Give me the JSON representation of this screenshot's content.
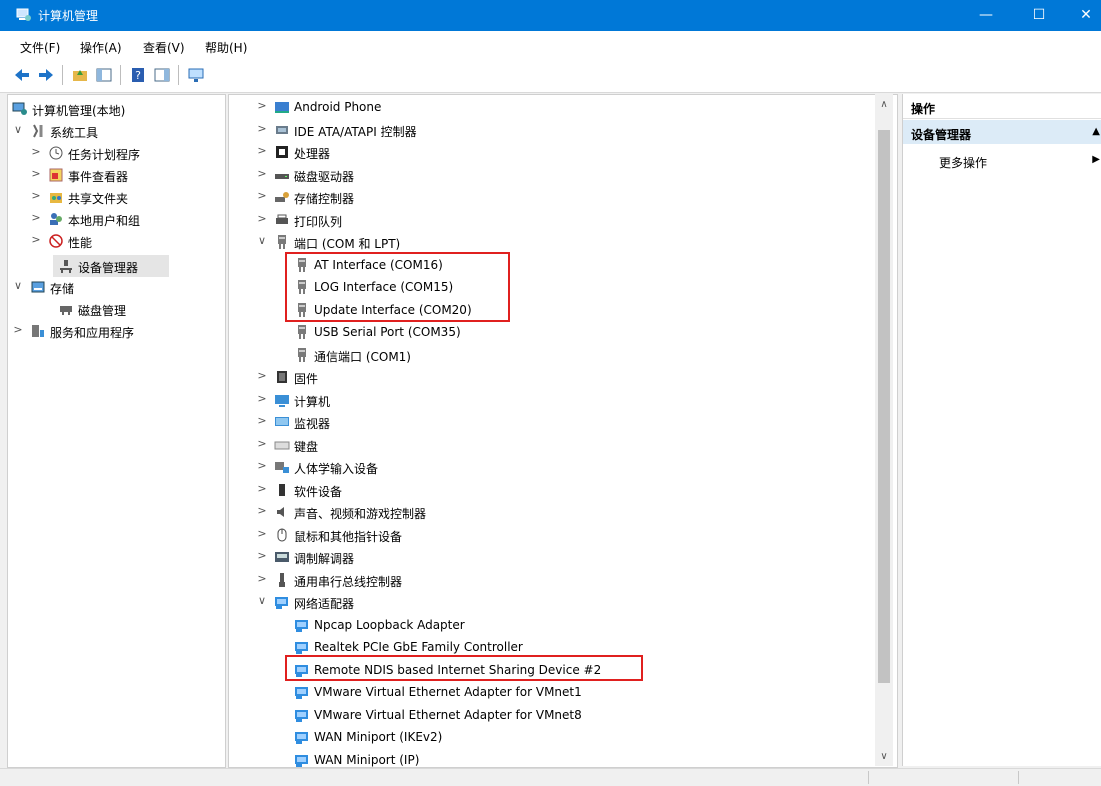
{
  "window": {
    "title": "计算机管理",
    "minimize_glyph": "—",
    "maximize_glyph": "☐",
    "close_glyph": "✕"
  },
  "menu": [
    "文件(F)",
    "操作(A)",
    "查看(V)",
    "帮助(H)"
  ],
  "left_tree": [
    {
      "label": "计算机管理(本地)",
      "icon": "computer-management-icon",
      "expander": ""
    },
    {
      "label": "系统工具",
      "icon": "system-tools-icon",
      "expander": "∨"
    },
    {
      "label": "任务计划程序",
      "icon": "task-scheduler-icon",
      "expander": ">"
    },
    {
      "label": "事件查看器",
      "icon": "event-viewer-icon",
      "expander": ">"
    },
    {
      "label": "共享文件夹",
      "icon": "shared-folders-icon",
      "expander": ">"
    },
    {
      "label": "本地用户和组",
      "icon": "local-users-icon",
      "expander": ">"
    },
    {
      "label": "性能",
      "icon": "performance-icon",
      "expander": ">"
    },
    {
      "label": "设备管理器",
      "icon": "device-manager-icon",
      "expander": ""
    },
    {
      "label": "存储",
      "icon": "storage-icon",
      "expander": "∨"
    },
    {
      "label": "磁盘管理",
      "icon": "disk-management-icon",
      "expander": ""
    },
    {
      "label": "服务和应用程序",
      "icon": "services-apps-icon",
      "expander": ">"
    }
  ],
  "device_tree": [
    {
      "label": "Android Phone",
      "icon": "android-phone-icon",
      "expander": ">"
    },
    {
      "label": "IDE ATA/ATAPI 控制器",
      "icon": "ide-controller-icon",
      "expander": ">"
    },
    {
      "label": "处理器",
      "icon": "processor-icon",
      "expander": ">"
    },
    {
      "label": "磁盘驱动器",
      "icon": "disk-drive-icon",
      "expander": ">"
    },
    {
      "label": "存储控制器",
      "icon": "storage-controller-icon",
      "expander": ">"
    },
    {
      "label": "打印队列",
      "icon": "print-queue-icon",
      "expander": ">"
    },
    {
      "label": "端口 (COM 和 LPT)",
      "icon": "port-icon",
      "expander": "∨"
    },
    {
      "label": "AT Interface (COM16)",
      "icon": "port-icon",
      "expander": ""
    },
    {
      "label": "LOG Interface (COM15)",
      "icon": "port-icon",
      "expander": ""
    },
    {
      "label": "Update Interface (COM20)",
      "icon": "port-icon",
      "expander": ""
    },
    {
      "label": "USB Serial Port (COM35)",
      "icon": "port-icon",
      "expander": ""
    },
    {
      "label": "通信端口 (COM1)",
      "icon": "port-icon",
      "expander": ""
    },
    {
      "label": "固件",
      "icon": "firmware-icon",
      "expander": ">"
    },
    {
      "label": "计算机",
      "icon": "computer-icon",
      "expander": ">"
    },
    {
      "label": "监视器",
      "icon": "monitor-icon",
      "expander": ">"
    },
    {
      "label": "键盘",
      "icon": "keyboard-icon",
      "expander": ">"
    },
    {
      "label": "人体学输入设备",
      "icon": "hid-icon",
      "expander": ">"
    },
    {
      "label": "软件设备",
      "icon": "software-device-icon",
      "expander": ">"
    },
    {
      "label": "声音、视频和游戏控制器",
      "icon": "sound-icon",
      "expander": ">"
    },
    {
      "label": "鼠标和其他指针设备",
      "icon": "mouse-icon",
      "expander": ">"
    },
    {
      "label": "调制解调器",
      "icon": "modem-icon",
      "expander": ">"
    },
    {
      "label": "通用串行总线控制器",
      "icon": "usb-controller-icon",
      "expander": ">"
    },
    {
      "label": "网络适配器",
      "icon": "network-adapter-icon",
      "expander": "∨"
    },
    {
      "label": "Npcap Loopback Adapter",
      "icon": "network-adapter-icon",
      "expander": ""
    },
    {
      "label": "Realtek PCIe GbE Family Controller",
      "icon": "network-adapter-icon",
      "expander": ""
    },
    {
      "label": "Remote NDIS based Internet Sharing Device #2",
      "icon": "network-adapter-icon",
      "expander": ""
    },
    {
      "label": "VMware Virtual Ethernet Adapter for VMnet1",
      "icon": "network-adapter-icon",
      "expander": ""
    },
    {
      "label": "VMware Virtual Ethernet Adapter for VMnet8",
      "icon": "network-adapter-icon",
      "expander": ""
    },
    {
      "label": "WAN Miniport (IKEv2)",
      "icon": "network-adapter-icon",
      "expander": ""
    },
    {
      "label": "WAN Miniport (IP)",
      "icon": "network-adapter-icon",
      "expander": ""
    }
  ],
  "actions_pane": {
    "header": "操作",
    "section": "设备管理器",
    "more": "更多操作",
    "section_arrow": "▲",
    "more_arrow": "▶"
  },
  "scroll": {
    "up": "∧",
    "down": "∨"
  },
  "colors": {
    "titlebar": "#0078d7",
    "highlight": "#e0201f",
    "section_bg": "#dcebf7"
  }
}
